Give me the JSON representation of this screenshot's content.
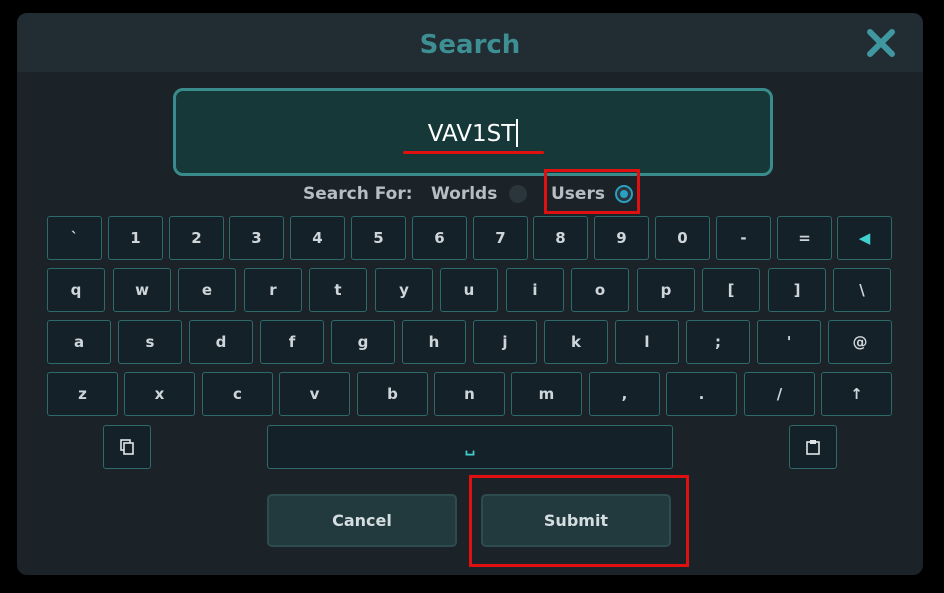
{
  "dialog": {
    "title": "Search",
    "close_icon": "close-icon",
    "accent_color": "#3d8f93"
  },
  "search": {
    "value": "VAV1ST"
  },
  "search_for": {
    "label": "Search For:",
    "options": [
      {
        "label": "Worlds",
        "selected": false
      },
      {
        "label": "Users",
        "selected": true
      }
    ]
  },
  "keyboard": {
    "rows": [
      [
        "`",
        "1",
        "2",
        "3",
        "4",
        "5",
        "6",
        "7",
        "8",
        "9",
        "0",
        "-",
        "=",
        "◀"
      ],
      [
        "q",
        "w",
        "e",
        "r",
        "t",
        "y",
        "u",
        "i",
        "o",
        "p",
        "[",
        "]",
        "\\"
      ],
      [
        "a",
        "s",
        "d",
        "f",
        "g",
        "h",
        "j",
        "k",
        "l",
        ";",
        "'",
        "@"
      ],
      [
        "z",
        "x",
        "c",
        "v",
        "b",
        "n",
        "m",
        ",",
        ".",
        "/",
        "↑"
      ]
    ],
    "space_label": "␣",
    "copy_icon": "copy-icon",
    "paste_icon": "paste-icon"
  },
  "buttons": {
    "cancel": "Cancel",
    "submit": "Submit"
  }
}
